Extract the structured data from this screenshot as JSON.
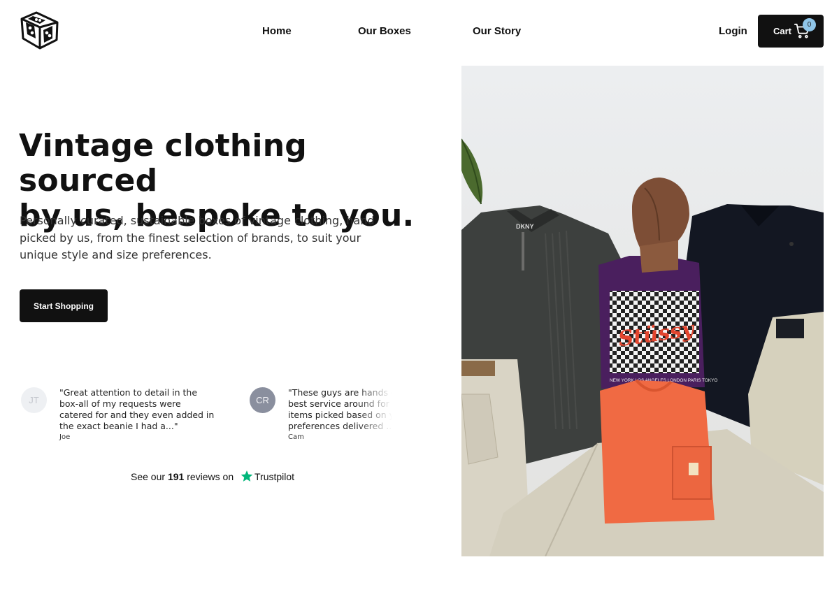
{
  "nav": {
    "home": "Home",
    "boxes": "Our Boxes",
    "story": "Our Story",
    "login": "Login",
    "cart_label": "Cart",
    "cart_count": "0"
  },
  "hero": {
    "headline_line1": "Vintage clothing sourced",
    "headline_line2": "by us, bespoke to you.",
    "subtext": "Personally curated, sustainable boxes of vintage clothing, hand picked by us, from the finest selection of brands, to suit your unique style and size preferences.",
    "cta": "Start Shopping",
    "image_labels": {
      "collar_brand": "DKNY",
      "tee_brand": "Stüssy",
      "tee_cities": "NEW YORK LOS ANGELES LONDON PARIS TOKYO"
    }
  },
  "reviews": [
    {
      "initials": "JT",
      "text": "\"Great attention to detail in the box-all of my requests were catered for and they even added in the exact beanie I had a...\"",
      "author": "Joe"
    },
    {
      "initials": "CR",
      "text": "\"These guys are hands down the best service around for vintage items picked based on your preferences delivered ...\"",
      "author": "Cam"
    }
  ],
  "trustpilot": {
    "prefix": "See our",
    "count": "191",
    "middle": "reviews on",
    "brand": "Trustpilot"
  },
  "colors": {
    "primary": "#111111",
    "badge": "#8fc5e8",
    "trustpilot_green": "#00b67a"
  }
}
